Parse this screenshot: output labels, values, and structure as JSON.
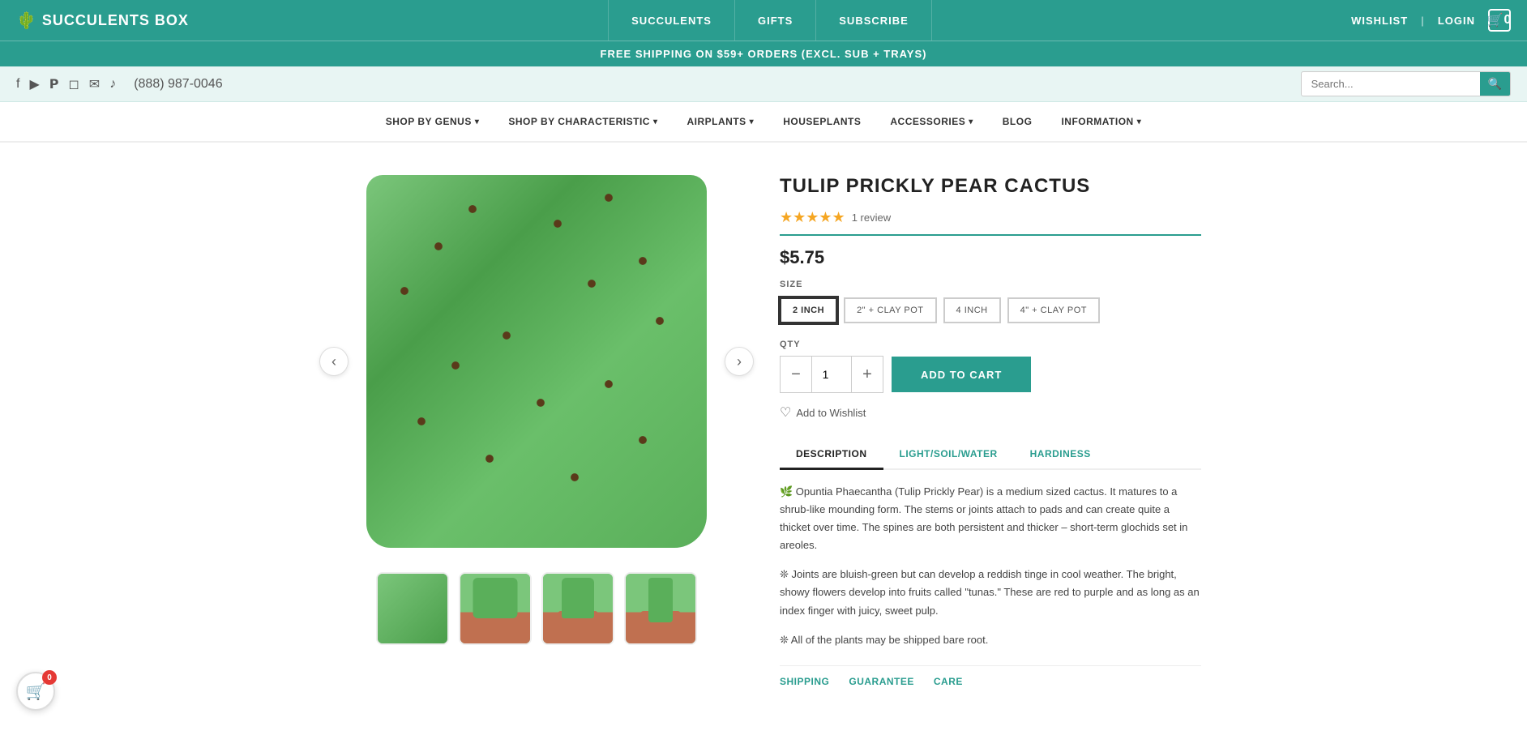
{
  "topNav": {
    "logo": "SUCCULENTS BOX",
    "logoIcon": "🌵",
    "menuItems": [
      {
        "label": "SUCCULENTS",
        "url": "#"
      },
      {
        "label": "GIFTS",
        "url": "#"
      },
      {
        "label": "SUBSCRIBE",
        "url": "#"
      }
    ],
    "wishlist": "WISHLIST",
    "login": "LOGIN",
    "cartCount": "0"
  },
  "promoBar": {
    "text": "FREE SHIPPING ON $59+ ORDERS (EXCL. SUB + TRAYS)"
  },
  "utilityBar": {
    "phone": "(888) 987-0046",
    "searchPlaceholder": "Search...",
    "searchLabel": "Search"
  },
  "subNav": {
    "items": [
      {
        "label": "SHOP BY GENUS",
        "hasDropdown": true
      },
      {
        "label": "SHOP BY CHARACTERISTIC",
        "hasDropdown": true
      },
      {
        "label": "AIRPLANTS",
        "hasDropdown": true
      },
      {
        "label": "HOUSEPLANTS",
        "hasDropdown": false
      },
      {
        "label": "ACCESSORIES",
        "hasDropdown": true
      },
      {
        "label": "BLOG",
        "hasDropdown": false
      },
      {
        "label": "INFORMATION",
        "hasDropdown": true
      }
    ]
  },
  "product": {
    "title": "TULIP PRICKLY PEAR CACTUS",
    "stars": "★★★★★",
    "reviewCount": "1 review",
    "price": "$5.75",
    "sizeLabel": "SIZE",
    "sizes": [
      {
        "label": "2 INCH",
        "selected": true
      },
      {
        "label": "2\" + CLAY POT",
        "selected": false
      },
      {
        "label": "4 INCH",
        "selected": false
      },
      {
        "label": "4\" + CLAY POT",
        "selected": false
      }
    ],
    "qtyLabel": "QTY",
    "qtyValue": "1",
    "addToCartLabel": "ADD TO CART",
    "wishlistLabel": "Add to Wishlist",
    "tabs": [
      {
        "label": "DESCRIPTION",
        "active": true
      },
      {
        "label": "LIGHT/SOIL/WATER",
        "active": false
      },
      {
        "label": "HARDINESS",
        "active": false
      }
    ],
    "descriptionParagraphs": [
      "🌿 Opuntia Phaecantha (Tulip Prickly Pear) is a medium sized cactus. It matures to a shrub-like mounding form. The stems or joints attach to pads and can create quite a thicket over time. The spines are both persistent and thicker – short-term glochids set in areoles.",
      "❊ Joints are bluish-green but can develop a reddish tinge in cool weather. The bright, showy flowers develop into fruits called \"tunas.\" These are red to purple and as long as an index finger with juicy, sweet pulp.",
      "❊ All of the plants may be shipped bare root."
    ],
    "bottomTabs": [
      {
        "label": "SHIPPING"
      },
      {
        "label": "GUARANTEE"
      },
      {
        "label": "CARE"
      }
    ]
  },
  "floatingCart": {
    "icon": "🛒",
    "badge": "0"
  }
}
